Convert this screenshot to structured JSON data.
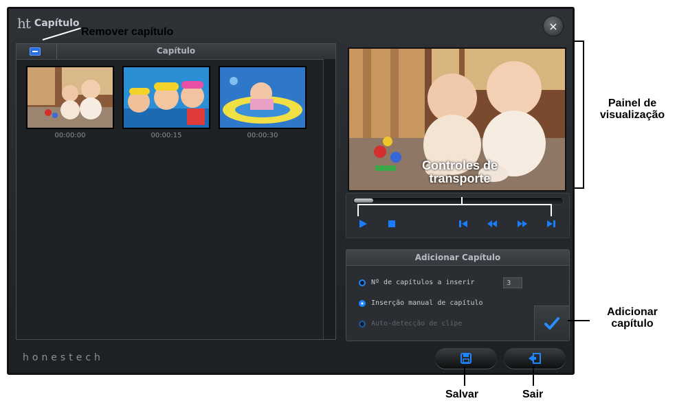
{
  "window": {
    "logo_text": "ht",
    "title": "Capítulo",
    "close_glyph": "×"
  },
  "chapter_panel": {
    "header_label": "Capítulo",
    "thumbnails": [
      {
        "time": "00:00:00"
      },
      {
        "time": "00:00:15"
      },
      {
        "time": "00:00:30"
      }
    ]
  },
  "transport": {
    "buttons": [
      "play-icon",
      "stop-icon",
      "skip-start-icon",
      "rewind-icon",
      "fast-forward-icon",
      "skip-end-icon"
    ]
  },
  "add_chapter": {
    "header": "Adicionar Capítulo",
    "options": [
      {
        "label": "Nº de capítulos a inserir",
        "selected": false,
        "enabled": true
      },
      {
        "label": "Inserção manual de capítulo",
        "selected": true,
        "enabled": true
      },
      {
        "label": "Auto-detecção de clipe",
        "selected": false,
        "enabled": false
      }
    ],
    "chapter_count": "3"
  },
  "footer": {
    "brand": "honestech"
  },
  "callouts": {
    "remove_chapter": "Remover capítulo",
    "preview_panel": "Painel de visualização",
    "transport_controls": "Controles de transporte",
    "add_chapter": "Adicionar capítulo",
    "save": "Salvar",
    "exit": "Sair"
  },
  "colors": {
    "accent": "#1f86ff",
    "window_bg": "#25292d"
  }
}
